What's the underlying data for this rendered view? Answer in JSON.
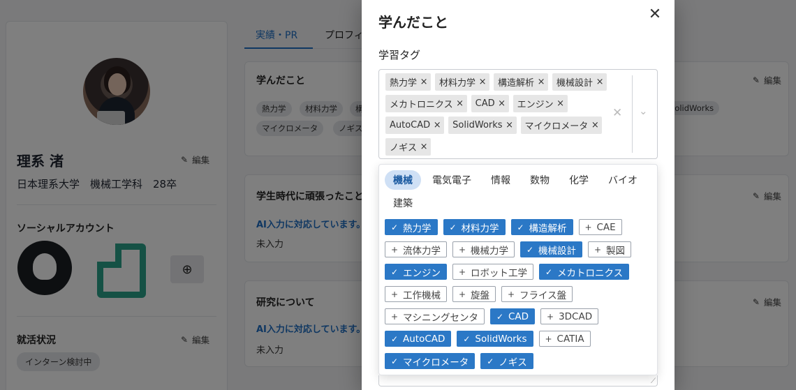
{
  "profile": {
    "name": "理系 渚",
    "school": "日本理系大学　機械工学科　28卒",
    "edit_label": "編集",
    "social_title": "ソーシャルアカウント",
    "job_title": "就活状況",
    "job_status": "インターン検討中"
  },
  "tabs": [
    {
      "label": "実績・PR"
    },
    {
      "label": "プロフィ"
    }
  ],
  "cards": [
    {
      "title": "学んだこと",
      "tags": [
        "熱力学",
        "材料力学",
        "構",
        "マイクロメータ",
        "ノギス"
      ],
      "right_tag": "SolidWorks"
    },
    {
      "title": "学生時代に頑張ったこと",
      "ai_note": "AI入力に対応しています。",
      "empty": "未入力"
    },
    {
      "title": "研究について",
      "ai_note": "AI入力に対応しています。",
      "empty": "未入力"
    }
  ],
  "modal": {
    "title": "学んだこと",
    "field_label": "学習タグ",
    "selected": [
      "熱力学",
      "材料力学",
      "構造解析",
      "機械設計",
      "メカトロニクス",
      "CAD",
      "エンジン",
      "AutoCAD",
      "SolidWorks",
      "マイクロメータ",
      "ノギス"
    ],
    "categories": [
      {
        "label": "機械",
        "active": true
      },
      {
        "label": "電気電子",
        "active": false
      },
      {
        "label": "情報",
        "active": false
      },
      {
        "label": "数物",
        "active": false
      },
      {
        "label": "化学",
        "active": false
      },
      {
        "label": "バイオ",
        "active": false
      },
      {
        "label": "建築",
        "active": false
      }
    ],
    "options": [
      {
        "label": "熱力学",
        "checked": true
      },
      {
        "label": "材料力学",
        "checked": true
      },
      {
        "label": "構造解析",
        "checked": true
      },
      {
        "label": "CAE",
        "checked": false
      },
      {
        "label": "流体力学",
        "checked": false
      },
      {
        "label": "機械力学",
        "checked": false
      },
      {
        "label": "機械設計",
        "checked": true
      },
      {
        "label": "製図",
        "checked": false
      },
      {
        "label": "エンジン",
        "checked": true
      },
      {
        "label": "ロボット工学",
        "checked": false
      },
      {
        "label": "メカトロニクス",
        "checked": true
      },
      {
        "label": "工作機械",
        "checked": false
      },
      {
        "label": "旋盤",
        "checked": false
      },
      {
        "label": "フライス盤",
        "checked": false
      },
      {
        "label": "マシニングセンタ",
        "checked": false
      },
      {
        "label": "CAD",
        "checked": true
      },
      {
        "label": "3DCAD",
        "checked": false
      },
      {
        "label": "AutoCAD",
        "checked": true
      },
      {
        "label": "SolidWorks",
        "checked": true
      },
      {
        "label": "CATIA",
        "checked": false
      },
      {
        "label": "マイクロメータ",
        "checked": true
      },
      {
        "label": "ノギス",
        "checked": true
      }
    ],
    "icons": {
      "close": "close-icon",
      "clear": "clear-icon",
      "chevron": "chevron-down-icon",
      "check": "check-icon",
      "plus": "plus-icon"
    },
    "colors": {
      "primary": "#2b78c6",
      "active_tab_bg": "#cfe0f5"
    }
  }
}
